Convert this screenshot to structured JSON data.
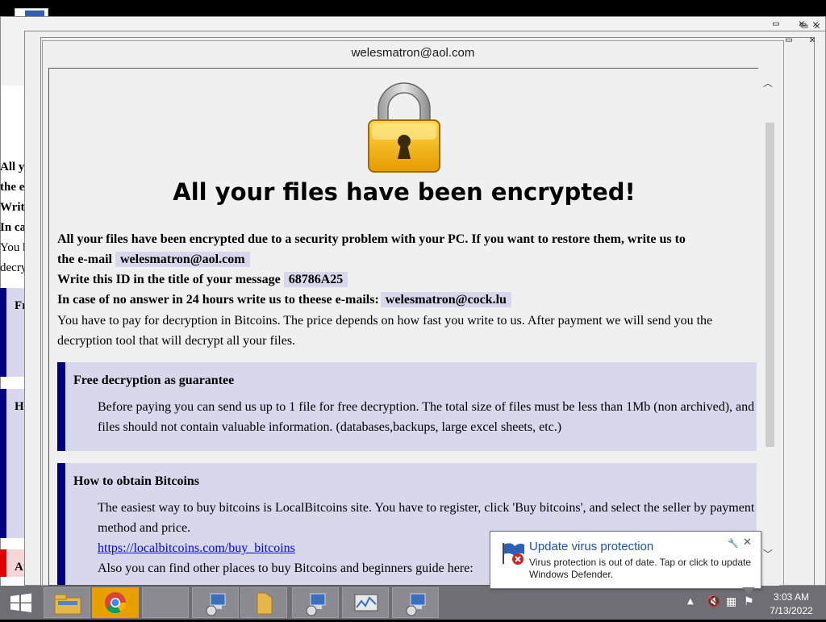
{
  "window": {
    "title": "welesmatron@aol.com"
  },
  "note": {
    "headline": "All your files have been encrypted!",
    "line1": "All your files have been encrypted due to a security problem with your PC. If you want to restore them, write us to",
    "line2_prefix": "the e-mail",
    "email": "welesmatron@aol.com",
    "line3_prefix": "Write this ID in the title of your message",
    "id": "68786A25",
    "line4_prefix": "In case of no answer in 24 hours write us to theese e-mails:",
    "email2": "welesmatron@cock.lu",
    "payment": "You have to pay for decryption in Bitcoins. The price depends on how fast you write to us. After payment we will send you the decryption tool that will decrypt all your files.",
    "box1_title": "Free decryption as guarantee",
    "box1_body": "Before paying you can send us up to 1 file for free decryption. The total size of files must be less than 1Mb (non archived), and files should not contain valuable information. (databases,backups, large excel sheets, etc.)",
    "box2_title": "How to obtain Bitcoins",
    "box2_body": "The easiest way to buy bitcoins is LocalBitcoins site. You have to register, click 'Buy bitcoins', and select the seller by payment method and price.",
    "box2_link": "https://localbitcoins.com/buy_bitcoins",
    "box2_more": "Also you can find other places to buy Bitcoins and beginners guide here:"
  },
  "background": {
    "lines": [
      "All you",
      "the e-m",
      "Write t",
      "In case",
      "You hav",
      "decrypti"
    ],
    "box_labels": [
      "Free",
      "How",
      "Atte"
    ]
  },
  "chrome": {
    "pill": "rome"
  },
  "toast": {
    "title": "Update virus protection",
    "body": "Virus protection is out of date. Tap or click to update Windows Defender."
  },
  "taskbar": {
    "time": "3:03 AM",
    "date": "7/13/2022"
  },
  "icons": {
    "lock": "padlock-icon",
    "start": "windows-logo-icon",
    "shield": "defender-shield-icon"
  },
  "colors": {
    "box_fill": "#d8d8ec",
    "box_border": "#000080",
    "taskbar": "#6e6e74",
    "toast_title": "#1a55b3"
  }
}
